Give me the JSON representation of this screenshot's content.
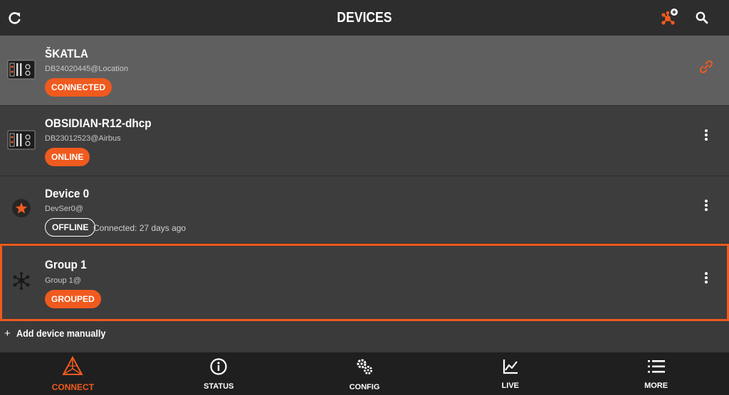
{
  "header": {
    "title": "DEVICES",
    "left_icon": "refresh-icon",
    "right_icons": [
      "network-add-icon",
      "search-icon"
    ]
  },
  "devices": [
    {
      "name": "ŠKATLA",
      "subtitle": "DB24020445@Location",
      "status": "CONNECTED",
      "icon": "device-unit-icon",
      "action_icon": "link-icon",
      "selected": true
    },
    {
      "name": "OBSIDIAN-R12-dhcp",
      "subtitle": "DB23012523@Airbus",
      "status": "ONLINE",
      "icon": "device-unit-icon",
      "action_icon": "more-vertical-icon"
    },
    {
      "name": "Device 0",
      "subtitle": "DevSer0@",
      "status": "OFFLINE",
      "status_detail": "Connected: 27 days ago",
      "icon": "star-icon",
      "action_icon": "more-vertical-icon"
    },
    {
      "name": "Group 1",
      "subtitle": "Group 1@",
      "status": "GROUPED",
      "icon": "group-network-icon",
      "action_icon": "more-vertical-icon",
      "highlighted": true
    }
  ],
  "add_manual": {
    "plus": "+",
    "label": "Add device manually"
  },
  "nav": [
    {
      "label": "CONNECT",
      "icon": "connect-triangle-icon",
      "active": true
    },
    {
      "label": "STATUS",
      "icon": "info-icon"
    },
    {
      "label": "CONFIG",
      "icon": "gears-icon"
    },
    {
      "label": "LIVE",
      "icon": "line-chart-icon"
    },
    {
      "label": "MORE",
      "icon": "list-icon"
    }
  ],
  "colors": {
    "accent": "#f05a1e",
    "header_bg": "#2d2d2d",
    "list_bg": "#3a3a3a",
    "selected_row_bg": "#5f5f5f",
    "nav_bg": "#1f1f1f"
  }
}
